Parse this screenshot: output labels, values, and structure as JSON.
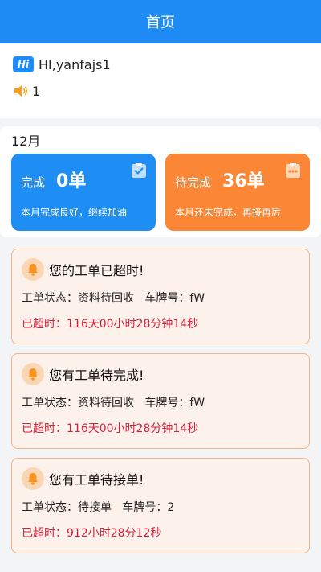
{
  "header": {
    "title": "首页"
  },
  "greeting": {
    "badge": "Hi",
    "text": "HI,yanfajs1",
    "notice_count": "1"
  },
  "month": {
    "label": "12月",
    "completed": {
      "label": "完成",
      "value": "0单",
      "desc": "本月完成良好，继续加油",
      "icon": "clipboard-check-icon",
      "color": "#1e8ef5"
    },
    "pending": {
      "label": "待完成",
      "value": "36单",
      "desc": "本月还未完成，再接再厉",
      "icon": "clipboard-dots-icon",
      "color": "#fb8736"
    }
  },
  "alerts": [
    {
      "title": "您的工单已超时!",
      "status_text": "工单状态：资料待回收",
      "plate_text": "车牌号：fW",
      "overdue": "已超时：116天00小时28分钟14秒"
    },
    {
      "title": "您有工单待完成!",
      "status_text": "工单状态：资料待回收",
      "plate_text": "车牌号：fW",
      "overdue": "已超时：116天00小时28分钟14秒"
    },
    {
      "title": "您有工单待接单!",
      "status_text": "工单状态：待接单",
      "plate_text": "车牌号：2",
      "overdue": "已超时：912小时28分12秒"
    }
  ],
  "colors": {
    "brand": "#1f8cf6",
    "alert_border": "#f2b48c",
    "alert_bg": "#fdf1ec",
    "overdue_text": "#d6203a"
  }
}
